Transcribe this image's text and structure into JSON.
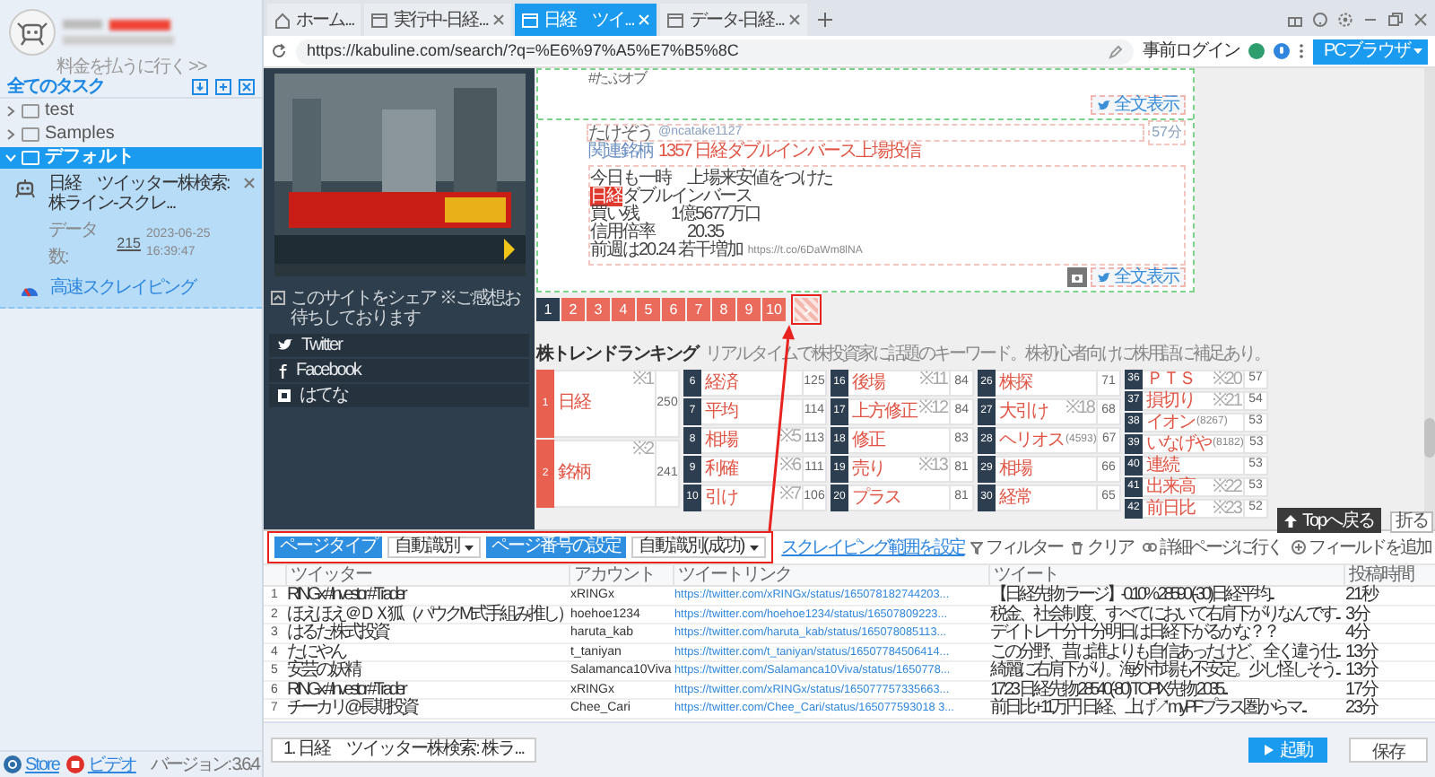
{
  "sidebar": {
    "pay_link": "料金を払うに行く >>",
    "all_tasks": "全てのタスク",
    "tree": [
      {
        "label": "test",
        "expanded": false,
        "selected": false
      },
      {
        "label": "Samples",
        "expanded": false,
        "selected": false
      },
      {
        "label": "デフォルト",
        "expanded": true,
        "selected": true,
        "children": [
          {
            "title": "日経　ツイッター株検索: 株ライン-スクレ...",
            "count_label": "データ数:",
            "count": "215",
            "time": "2023-06-25 16:39:47",
            "mode": "高速スクレイピング"
          }
        ]
      }
    ],
    "footer_links": [
      "Store",
      "ビデオ"
    ],
    "version": "バージョン: 3.6.4"
  },
  "tabs": [
    {
      "kind": "home",
      "label": "ホーム...",
      "selected": false
    },
    {
      "kind": "page",
      "label": "実行中-日経...",
      "selected": false
    },
    {
      "kind": "page",
      "label": "日経　ツイ...",
      "selected": true
    },
    {
      "kind": "page",
      "label": "データ-日経...",
      "selected": false
    }
  ],
  "address_bar": {
    "url": "https://kabuline.com/search/?q=%E6%97%A5%E7%B5%8C",
    "login": "事前ログイン",
    "browser_button": "PCブラウザ"
  },
  "site": {
    "share": {
      "title": "このサイトをシェア ※ご感想お待ちしております",
      "items": [
        "Twitter",
        "Facebook",
        "はてな"
      ]
    },
    "previous_tweet": {
      "text": "#たぶオブ",
      "button": "全文表示"
    },
    "tweet": {
      "name": "たけぞう",
      "handle": "@ncatake1127",
      "time": "57分",
      "related_label": "関連銘柄",
      "related": "1357 日経ダブルインバース上場投信",
      "lines": [
        "今日も一時　上場来安値をつけた",
        "**日経**ダブルインバース",
        "買い残　　1億5677万口",
        "信用倍率　　20.35",
        "前週は20.24 若干増加"
      ],
      "link": "https://t.co/6DaWm8lNA",
      "button": "全文表示"
    },
    "pagination": [
      {
        "label": "1",
        "selected": true
      },
      {
        "label": "2",
        "selected": false
      },
      {
        "label": "3",
        "selected": false
      },
      {
        "label": "4",
        "selected": false
      },
      {
        "label": "5",
        "selected": false
      },
      {
        "label": "6",
        "selected": false
      },
      {
        "label": "7",
        "selected": false
      },
      {
        "label": "8",
        "selected": false
      },
      {
        "label": "9",
        "selected": false
      },
      {
        "label": "10",
        "selected": false
      }
    ],
    "ranking": {
      "title": "株トレンドランキング",
      "subtitle": "リアルタイムで株投資家に話題のキーワード。株初心者向けに株用語に補足あり。",
      "columns": [
        {
          "color": "#e8604f",
          "entries": [
            {
              "rank": "1",
              "word": "日経",
              "note": "※1",
              "count": "250"
            },
            {
              "rank": "2",
              "word": "銘柄",
              "note": "※2",
              "count": "241"
            }
          ]
        },
        {
          "color": "#2c3e50",
          "entries": [
            {
              "rank": "6",
              "word": "経済",
              "count": "125"
            },
            {
              "rank": "7",
              "word": "平均",
              "count": "114"
            },
            {
              "rank": "8",
              "word": "相場",
              "note": "※5",
              "count": "113"
            },
            {
              "rank": "9",
              "word": "利確",
              "note": "※6",
              "count": "111"
            },
            {
              "rank": "10",
              "word": "引け",
              "note": "※7",
              "count": "106"
            }
          ]
        },
        {
          "color": "#2c3e50",
          "entries": [
            {
              "rank": "16",
              "word": "後場",
              "note": "※11",
              "count": "84"
            },
            {
              "rank": "17",
              "word": "上方修正",
              "note": "※12",
              "count": "84"
            },
            {
              "rank": "18",
              "word": "修正",
              "count": "83"
            },
            {
              "rank": "19",
              "word": "売り",
              "note": "※13",
              "count": "81"
            },
            {
              "rank": "20",
              "word": "プラス",
              "count": "81"
            }
          ]
        },
        {
          "color": "#2c3e50",
          "entries": [
            {
              "rank": "26",
              "word": "株探",
              "count": "71"
            },
            {
              "rank": "27",
              "word": "大引け",
              "note": "※18",
              "count": "68"
            },
            {
              "rank": "28",
              "word": "ヘリオス",
              "code": "(4593)",
              "count": "67"
            },
            {
              "rank": "29",
              "word": "相場",
              "count": "66"
            },
            {
              "rank": "30",
              "word": "経常",
              "count": "65"
            }
          ]
        },
        {
          "color": "#2c3e50",
          "entries": [
            {
              "rank": "36",
              "word": "ＰＴＳ",
              "note": "※20",
              "count": "57"
            },
            {
              "rank": "37",
              "word": "損切り",
              "note": "※21",
              "count": "54"
            },
            {
              "rank": "38",
              "word": "イオン",
              "code": "(8267)",
              "count": "53"
            },
            {
              "rank": "39",
              "word": "いなげや",
              "code": "(8182)",
              "count": "53"
            },
            {
              "rank": "40",
              "word": "連続",
              "count": "53"
            },
            {
              "rank": "41",
              "word": "出来高",
              "note": "※22",
              "count": "53"
            },
            {
              "rank": "42",
              "word": "前日比",
              "note": "※23",
              "count": "52"
            }
          ]
        }
      ]
    },
    "top_button": "Topへ戻る",
    "fold_button": "折る"
  },
  "task_panel": {
    "page_type": {
      "label": "ページタイプ",
      "value": "自動識別"
    },
    "page_number": {
      "label": "ページ番号の設定",
      "value": "自動識別(成功)"
    },
    "range_link": "スクレイピング範囲を設定",
    "tools": [
      {
        "kind": "filter",
        "label": "フィルター"
      },
      {
        "kind": "clear",
        "label": "クリア"
      },
      {
        "kind": "link",
        "label": "詳細ページに行く"
      },
      {
        "kind": "add",
        "label": "フィールドを追加"
      }
    ]
  },
  "table": {
    "columns": [
      "ツイッター",
      "アカウント",
      "ツイートリンク",
      "ツイート",
      "投稿時間"
    ],
    "rows": [
      {
        "index": "1",
        "cells": [
          "RINGx #Investor #Trader",
          "xRINGx",
          "https://twitter.com/xRINGx/status/165078182744203...",
          "【日経先物 ラージ】-0.10% 28590 (-30)日経平均...",
          "21秒"
        ]
      },
      {
        "index": "2",
        "cells": [
          "ほえほえ＠ＤＸ狐（パウクM式手組み推し）",
          "hoehoe1234",
          "https://twitter.com/hoehoe1234/status/16507809223...",
          "税金、社会制度、すべてにおいて右肩下がりなんです...",
          "3分"
        ]
      },
      {
        "index": "3",
        "cells": [
          "はるた株式投資",
          "haruta_kab",
          "https://twitter.com/haruta_kab/status/165078085113...",
          "デイトレ十分十分明日は日経下がるかな？？",
          "4分"
        ]
      },
      {
        "index": "4",
        "cells": [
          "たにやん",
          "t_taniyan",
          "https://twitter.com/t_taniyan/status/16507784506414...",
          "この分野、昔は誰よりも自信あったけど、全く違う仕...",
          "13分"
        ]
      },
      {
        "index": "5",
        "cells": [
          "安芸の妖精",
          "Salamanca10Viva",
          "https://twitter.com/Salamanca10Viva/status/1650778...",
          "綺麗に右肩下がり。海外市場も不安定。少し怪しそう...",
          "13分"
        ]
      },
      {
        "index": "6",
        "cells": [
          "RINGx #Investor #Trader",
          "xRINGx",
          "https://twitter.com/xRINGx/status/165077757335663...",
          "17:23 日経先物 28540(-80) TOPIX先物 2035...",
          "17分"
        ]
      },
      {
        "index": "7",
        "cells": [
          "チーカリ@長期投資",
          "Chee_Cari",
          "https://twitter.com/Chee_Cari/status/165077593018 3...",
          "前日比+11万円 日経、上げ↗myPFプラス圏からマ...",
          "23分"
        ]
      }
    ]
  },
  "bottom_bar": {
    "task_tab": "1. 日経　ツイッター株検索: 株ラ...",
    "start": "起動",
    "save": "保存"
  }
}
